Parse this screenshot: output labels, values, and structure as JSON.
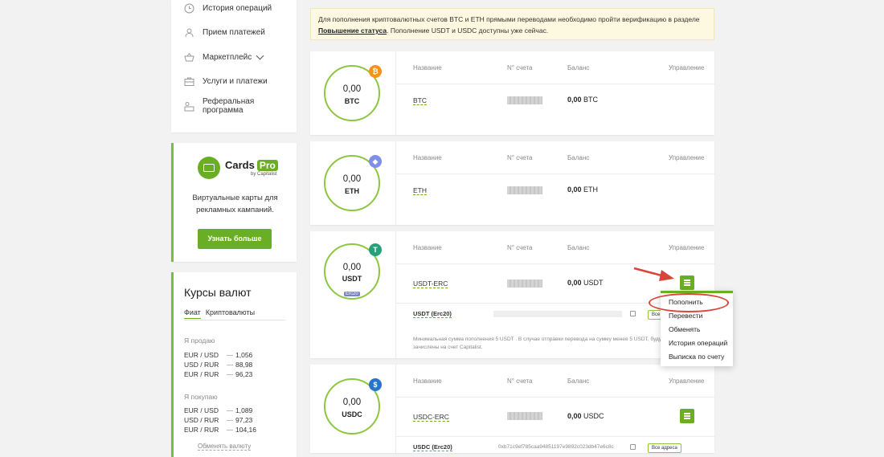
{
  "sidebar": {
    "nav": [
      {
        "label": "История операций",
        "icon": "clock-icon"
      },
      {
        "label": "Прием платежей",
        "icon": "user-icon"
      },
      {
        "label": "Маркетплейс",
        "icon": "basket-icon"
      },
      {
        "label": "Услуги и платежи",
        "icon": "briefcase-icon"
      },
      {
        "label": "Реферальная программа",
        "icon": "referral-icon"
      }
    ],
    "cards": {
      "brand": "Cards",
      "brand_pro": "Pro",
      "by": "by Capitalist",
      "description_line1": "Виртуальные карты для",
      "description_line2": "рекламных кампаний.",
      "button": "Узнать больше"
    },
    "rates": {
      "title": "Курсы валют",
      "tabs": [
        "Фиат",
        "Криптовалюты"
      ],
      "sell_label": "Я продаю",
      "sell": [
        {
          "pair": "EUR / USD",
          "value": "1,056"
        },
        {
          "pair": "USD / RUR",
          "value": "88,98"
        },
        {
          "pair": "EUR / RUR",
          "value": "96,23"
        }
      ],
      "buy_label": "Я покупаю",
      "buy": [
        {
          "pair": "EUR / USD",
          "value": "1,089"
        },
        {
          "pair": "USD / RUR",
          "value": "97,23"
        },
        {
          "pair": "EUR / RUR",
          "value": "104,16"
        }
      ],
      "exchange_link": "Обменять валюту"
    }
  },
  "notice": {
    "text_before": "Для пополнения криптовалютных счетов BTC и ETH прямыми переводами необходимо пройти верификацию в разделе ",
    "link": "Повышение статуса",
    "text_after": ". Пополнение USDT и USDC доступны уже сейчас."
  },
  "headers": {
    "name": "Название",
    "number": "N° счета",
    "balance": "Баланс",
    "manage": "Управление"
  },
  "accounts": [
    {
      "amount": "0,00",
      "currency": "BTC",
      "name": "BTC",
      "balance_value": "0,00",
      "balance_currency": "BTC",
      "badge": "₿",
      "badge_color": "#f7931a"
    },
    {
      "amount": "0,00",
      "currency": "ETH",
      "name": "ETH",
      "balance_value": "0,00",
      "balance_currency": "ETH",
      "badge": "◆",
      "badge_color": "#7d8fe8"
    },
    {
      "amount": "0,00",
      "currency": "USDT",
      "tag": "Erc20",
      "name": "USDT-ERC",
      "balance_value": "0,00",
      "balance_currency": "USDT",
      "badge": "T",
      "badge_color": "#26a17b",
      "address_label": "USDT (Erc20)",
      "address_chip": "Все адреса",
      "note": "Минимальная сумма пополнения 5 USDT . В случае отправки перевода на сумму менее 5 USDT, будут зачислены на счет Capitalist."
    },
    {
      "amount": "0,00",
      "currency": "USDC",
      "name": "USDC-ERC",
      "balance_value": "0,00",
      "balance_currency": "USDC",
      "badge": "$",
      "badge_color": "#2775ca",
      "address_label": "USDC (Erc20)",
      "address_value": "0xb71c9ef785caa94851197e9892c023db47e6c8c",
      "address_chip": "Все адреса"
    }
  ],
  "dropdown": [
    "Пополнить",
    "Перевести",
    "Обменять",
    "История операций",
    "Выписка по счету"
  ],
  "colors": {
    "accent": "#6aae26",
    "annotation": "#d9453a",
    "notice_bg": "#fdf9e0"
  }
}
